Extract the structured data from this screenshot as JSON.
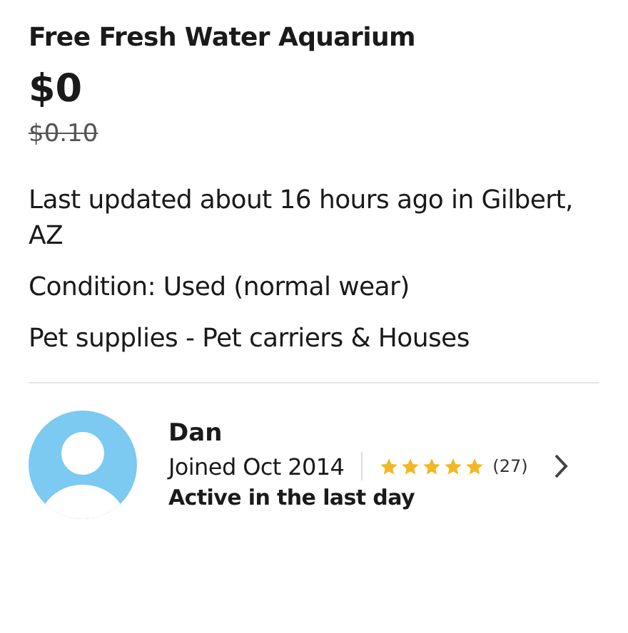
{
  "listing": {
    "title": "Free Fresh Water Aquarium",
    "price": "$0",
    "original_price": "$0.10",
    "updated": "Last updated about 16 hours ago in Gilbert, AZ",
    "condition": "Condition: Used (normal wear)",
    "category": "Pet supplies - Pet carriers & Houses"
  },
  "seller": {
    "name": "Dan",
    "joined": "Joined Oct 2014",
    "stars": 5,
    "rating_count": "(27)",
    "activity": "Active in the last day"
  }
}
